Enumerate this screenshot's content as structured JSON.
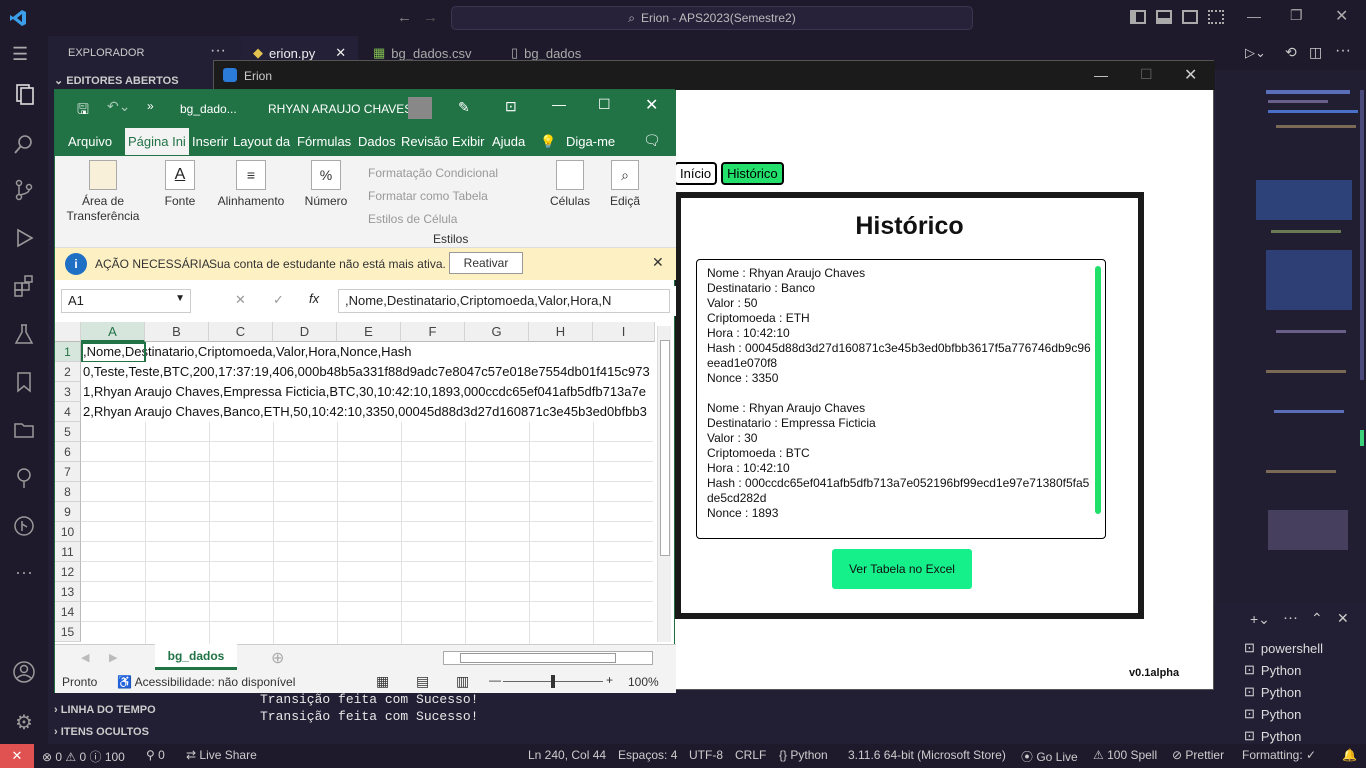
{
  "vscode": {
    "command_center": "Erion - APS2023(Semestre2)",
    "explorer_title": "EXPLORADOR",
    "open_editors": "EDITORES ABERTOS",
    "timeline": "LINHA DO TEMPO",
    "hidden_items": "ITENS OCULTOS",
    "tabs": [
      {
        "label": "erion.py"
      },
      {
        "label": "bg_dados.csv"
      },
      {
        "label": "bg_dados"
      }
    ],
    "terminal_lines": [
      "Transição feita com Sucesso!",
      "Transição feita com Sucesso!"
    ],
    "terminals": [
      "powershell",
      "Python",
      "Python",
      "Python",
      "Python"
    ],
    "status": {
      "problems": "⊗ 0 ⚠ 0 ⓘ 100",
      "ports": "⚲ 0",
      "live_share": "Live Share",
      "position": "Ln 240, Col 44",
      "spaces": "Espaços: 4",
      "encoding": "UTF-8",
      "eol": "CRLF",
      "language": "Python",
      "interpreter": "3.11.6 64-bit (Microsoft Store)",
      "go_live": "Go Live",
      "spell": "100 Spell",
      "prettier": "Prettier",
      "formatting": "Formatting: ✓"
    }
  },
  "erion": {
    "window_title": "Erion",
    "nav": {
      "inicio": "Início",
      "historico": "Histórico"
    },
    "history_title": "Histórico",
    "records": [
      [
        "Nome : Rhyan Araujo Chaves",
        "Destinatario : Banco",
        "Valor : 50",
        "Criptomoeda : ETH",
        "Hora : 10:42:10",
        "Hash : 00045d88d3d27d160871c3e45b3ed0bfbb3617f5a776746db9c96eead1e070f8",
        "Nonce : 3350"
      ],
      [
        "Nome : Rhyan Araujo Chaves",
        "Destinatario : Empressa Ficticia",
        "Valor : 30",
        "Criptomoeda : BTC",
        "Hora : 10:42:10",
        "Hash : 000ccdc65ef041afb5dfb713a7e052196bf99ecd1e97e71380f5fa5de5cd282d",
        "Nonce : 1893"
      ]
    ],
    "excel_button": "Ver Tabela no Excel",
    "version": "v0.1alpha"
  },
  "excel": {
    "file": "bg_dado...",
    "user": "RHYAN ARAUJO CHAVES",
    "menu": [
      "Arquivo",
      "Página Ini",
      "Inserir",
      "Layout da",
      "Fórmulas",
      "Dados",
      "Revisão",
      "Exibir",
      "Ajuda",
      "Diga-me"
    ],
    "ribbon": {
      "clipboard": "Área de Transferência",
      "font": "Fonte",
      "align": "Alinhamento",
      "number": "Número",
      "cond": "Formatação Condicional",
      "table": "Formatar como Tabela",
      "styles_cell": "Estilos de Célula",
      "styles": "Estilos",
      "cells": "Células",
      "edit": "Ediçã"
    },
    "warning": {
      "title": "AÇÃO NECESSÁRIA",
      "msg": "Sua conta de estudante não está mais ativa.",
      "button": "Reativar"
    },
    "namebox": "A1",
    "formula": ",Nome,Destinatario,Criptomoeda,Valor,Hora,N",
    "columns": [
      "A",
      "B",
      "C",
      "D",
      "E",
      "F",
      "G",
      "H",
      "I"
    ],
    "rows": [
      "1",
      "2",
      "3",
      "4",
      "5",
      "6",
      "7",
      "8",
      "9",
      "10",
      "11",
      "12",
      "13",
      "14",
      "15"
    ],
    "cells": [
      ",Nome,Destinatario,Criptomoeda,Valor,Hora,Nonce,Hash",
      "0,Teste,Teste,BTC,200,17:37:19,406,000b48b5a331f88d9adc7e8047c57e018e7554db01f415c973",
      "1,Rhyan Araujo Chaves,Empressa Ficticia,BTC,30,10:42:10,1893,000ccdc65ef041afb5dfb713a7e",
      "2,Rhyan Araujo Chaves,Banco,ETH,50,10:42:10,3350,00045d88d3d27d160871c3e45b3ed0bfbb3"
    ],
    "sheet": "bg_dados",
    "status": "Pronto",
    "accessibility": "Acessibilidade: não disponível",
    "zoom": "100%"
  }
}
